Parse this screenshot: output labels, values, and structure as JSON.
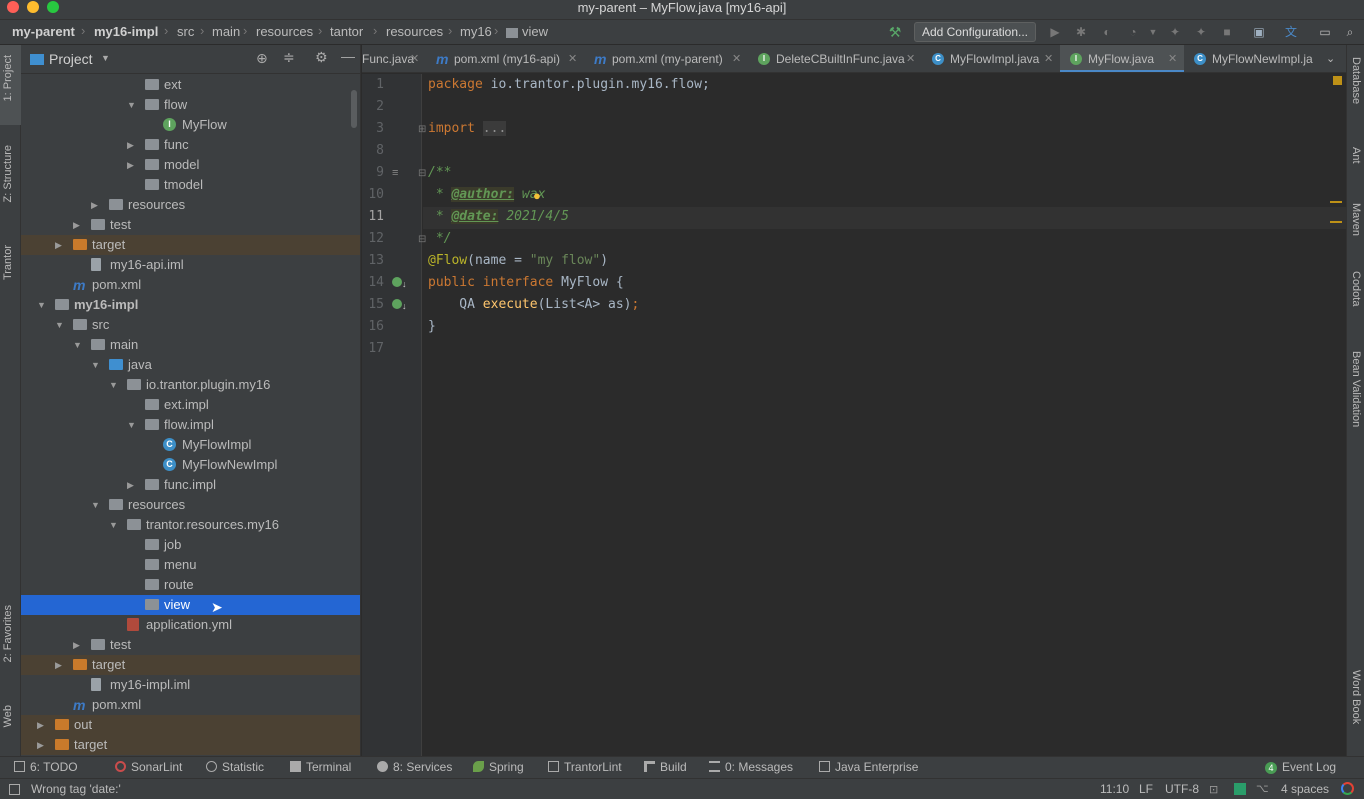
{
  "window": {
    "title": "my-parent – MyFlow.java [my16-api]"
  },
  "breadcrumbs": [
    "my-parent",
    "my16-impl",
    "src",
    "main",
    "resources",
    "tantor",
    "resources",
    "my16",
    "view"
  ],
  "toolbar": {
    "add_configuration": "Add Configuration..."
  },
  "left_strip": {
    "project": "1: Project",
    "structure": "Z: Structure",
    "tantor": "Trantor",
    "favorites": "2: Favorites",
    "web": "Web"
  },
  "right_strip": {
    "database": "Database",
    "ant": "Ant",
    "maven": "Maven",
    "codota": "Codota",
    "bean_validation": "Bean Validation",
    "word_book": "Word Book"
  },
  "project_panel": {
    "title": "Project",
    "tree": [
      {
        "label": "ext",
        "depth": 7,
        "icon": "folder",
        "arrow": ""
      },
      {
        "label": "flow",
        "depth": 7,
        "icon": "folder",
        "arrow": "down"
      },
      {
        "label": "MyFlow",
        "depth": 8,
        "icon": "interface",
        "arrow": ""
      },
      {
        "label": "func",
        "depth": 7,
        "icon": "folder",
        "arrow": "right"
      },
      {
        "label": "model",
        "depth": 7,
        "icon": "folder",
        "arrow": "right"
      },
      {
        "label": "tmodel",
        "depth": 7,
        "icon": "folder",
        "arrow": ""
      },
      {
        "label": "resources",
        "depth": 5,
        "icon": "res-folder",
        "arrow": "right"
      },
      {
        "label": "test",
        "depth": 4,
        "icon": "folder",
        "arrow": "right"
      },
      {
        "label": "target",
        "depth": 3,
        "icon": "orange-folder",
        "arrow": "right",
        "excluded": true
      },
      {
        "label": "my16-api.iml",
        "depth": 4,
        "icon": "file",
        "arrow": ""
      },
      {
        "label": "pom.xml",
        "depth": 3,
        "icon": "maven",
        "arrow": ""
      },
      {
        "label": "my16-impl",
        "depth": 2,
        "icon": "module",
        "arrow": "down",
        "bold": true
      },
      {
        "label": "src",
        "depth": 3,
        "icon": "folder",
        "arrow": "down"
      },
      {
        "label": "main",
        "depth": 4,
        "icon": "folder",
        "arrow": "down"
      },
      {
        "label": "java",
        "depth": 5,
        "icon": "blue-folder",
        "arrow": "down"
      },
      {
        "label": "io.trantor.plugin.my16",
        "depth": 6,
        "icon": "folder",
        "arrow": "down"
      },
      {
        "label": "ext.impl",
        "depth": 7,
        "icon": "folder",
        "arrow": ""
      },
      {
        "label": "flow.impl",
        "depth": 7,
        "icon": "folder",
        "arrow": "down"
      },
      {
        "label": "MyFlowImpl",
        "depth": 8,
        "icon": "class",
        "arrow": ""
      },
      {
        "label": "MyFlowNewImpl",
        "depth": 8,
        "icon": "class",
        "arrow": ""
      },
      {
        "label": "func.impl",
        "depth": 7,
        "icon": "folder",
        "arrow": "right"
      },
      {
        "label": "resources",
        "depth": 5,
        "icon": "res-folder",
        "arrow": "down"
      },
      {
        "label": "trantor.resources.my16",
        "depth": 6,
        "icon": "folder",
        "arrow": "down"
      },
      {
        "label": "job",
        "depth": 7,
        "icon": "folder",
        "arrow": ""
      },
      {
        "label": "menu",
        "depth": 7,
        "icon": "folder",
        "arrow": ""
      },
      {
        "label": "route",
        "depth": 7,
        "icon": "folder",
        "arrow": ""
      },
      {
        "label": "view",
        "depth": 7,
        "icon": "folder",
        "arrow": "",
        "selected": true
      },
      {
        "label": "application.yml",
        "depth": 6,
        "icon": "yml",
        "arrow": ""
      },
      {
        "label": "test",
        "depth": 4,
        "icon": "folder",
        "arrow": "right"
      },
      {
        "label": "target",
        "depth": 3,
        "icon": "orange-folder",
        "arrow": "right",
        "excluded": true
      },
      {
        "label": "my16-impl.iml",
        "depth": 4,
        "icon": "file",
        "arrow": ""
      },
      {
        "label": "pom.xml",
        "depth": 3,
        "icon": "maven",
        "arrow": ""
      },
      {
        "label": "out",
        "depth": 2,
        "icon": "orange-folder",
        "arrow": "right",
        "excluded": true
      },
      {
        "label": "target",
        "depth": 2,
        "icon": "orange-folder",
        "arrow": "right",
        "excluded": true
      }
    ]
  },
  "tabs": [
    {
      "label": "Func.java",
      "icon": "none",
      "active": false
    },
    {
      "label": "pom.xml (my16-api)",
      "icon": "maven",
      "active": false
    },
    {
      "label": "pom.xml (my-parent)",
      "icon": "maven",
      "active": false
    },
    {
      "label": "DeleteCBuiltInFunc.java",
      "icon": "interface",
      "active": false
    },
    {
      "label": "MyFlowImpl.java",
      "icon": "class",
      "active": false
    },
    {
      "label": "MyFlow.java",
      "icon": "interface",
      "active": true
    },
    {
      "label": "MyFlowNewImpl.ja",
      "icon": "class",
      "active": false
    }
  ],
  "editor": {
    "line_numbers": [
      "1",
      "2",
      "3",
      "8",
      "9",
      "10",
      "11",
      "12",
      "13",
      "14",
      "15",
      "16",
      "17"
    ],
    "current_line": "11",
    "code": {
      "l1_kw": "package",
      "l1_rest": " io.trantor.plugin.my16.flow;",
      "l3_kw": "import",
      "l3_fold": "...",
      "l9": "/**",
      "l10_star": " * ",
      "l10_tag": "@author:",
      "l10_val": " wax",
      "l11_star": " * ",
      "l11_tag": "@date:",
      "l11_val": " 2021/4/5",
      "l12": " */",
      "l13_ann": "@Flow",
      "l13_open": "(name = ",
      "l13_str": "\"my flow\"",
      "l13_close": ")",
      "l14_kw1": "public",
      "l14_kw2": "interface",
      "l14_rest": " MyFlow {",
      "l15_pre": "    QA ",
      "l15_meth": "execute",
      "l15_rest": "(List<A> as)",
      "l15_semi": ";",
      "l16": "}"
    }
  },
  "bottom_tools": [
    {
      "label": "6: TODO"
    },
    {
      "label": "SonarLint"
    },
    {
      "label": "Statistic"
    },
    {
      "label": "Terminal"
    },
    {
      "label": "8: Services"
    },
    {
      "label": "Spring"
    },
    {
      "label": "TrantorLint"
    },
    {
      "label": "Build"
    },
    {
      "label": "0: Messages"
    },
    {
      "label": "Java Enterprise"
    }
  ],
  "event_log": {
    "badge": "4",
    "label": "Event Log"
  },
  "status": {
    "message": "Wrong tag 'date:'",
    "position": "11:10",
    "line_sep": "LF",
    "encoding": "UTF-8",
    "indent": "4 spaces"
  },
  "colors": {
    "selection": "#2466d3",
    "excluded_bg": "#4b4133",
    "accent_tab": "#4a88c7"
  }
}
